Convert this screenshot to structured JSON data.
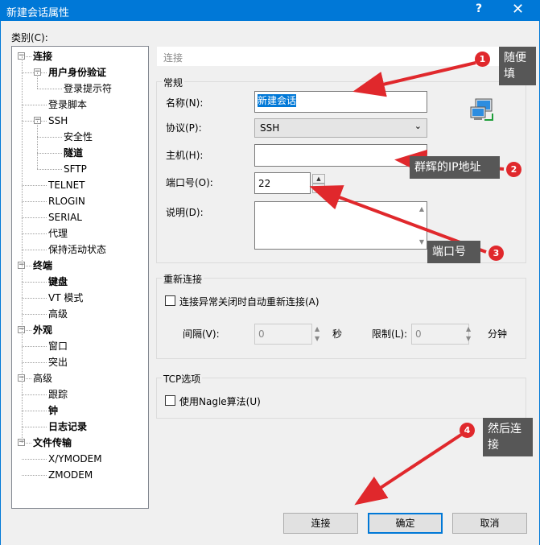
{
  "window": {
    "title": "新建会话属性",
    "help": "?",
    "close": "✕"
  },
  "category_label": "类别(C):",
  "tree": [
    {
      "label": "连接",
      "bold": true,
      "level": 0,
      "exp": "−"
    },
    {
      "label": "用户身份验证",
      "bold": true,
      "level": 1,
      "exp": "−"
    },
    {
      "label": "登录提示符",
      "bold": false,
      "level": 2
    },
    {
      "label": "登录脚本",
      "bold": false,
      "level": 1
    },
    {
      "label": "SSH",
      "bold": false,
      "level": 1,
      "exp": "−"
    },
    {
      "label": "安全性",
      "bold": false,
      "level": 2
    },
    {
      "label": "隧道",
      "bold": true,
      "level": 2
    },
    {
      "label": "SFTP",
      "bold": false,
      "level": 2
    },
    {
      "label": "TELNET",
      "bold": false,
      "level": 1
    },
    {
      "label": "RLOGIN",
      "bold": false,
      "level": 1
    },
    {
      "label": "SERIAL",
      "bold": false,
      "level": 1
    },
    {
      "label": "代理",
      "bold": false,
      "level": 1
    },
    {
      "label": "保持活动状态",
      "bold": false,
      "level": 1
    },
    {
      "label": "终端",
      "bold": true,
      "level": 0,
      "exp": "−"
    },
    {
      "label": "键盘",
      "bold": true,
      "level": 1
    },
    {
      "label": "VT 模式",
      "bold": false,
      "level": 1
    },
    {
      "label": "高级",
      "bold": false,
      "level": 1
    },
    {
      "label": "外观",
      "bold": true,
      "level": 0,
      "exp": "−"
    },
    {
      "label": "窗口",
      "bold": false,
      "level": 1
    },
    {
      "label": "突出",
      "bold": false,
      "level": 1
    },
    {
      "label": "高级",
      "bold": false,
      "level": 0,
      "exp": "−"
    },
    {
      "label": "跟踪",
      "bold": false,
      "level": 1
    },
    {
      "label": "钟",
      "bold": true,
      "level": 1
    },
    {
      "label": "日志记录",
      "bold": true,
      "level": 1
    },
    {
      "label": "文件传输",
      "bold": true,
      "level": 0,
      "exp": "−"
    },
    {
      "label": "X/YMODEM",
      "bold": false,
      "level": 1
    },
    {
      "label": "ZMODEM",
      "bold": false,
      "level": 1
    }
  ],
  "breadcrumb": "连接",
  "general": {
    "title": "常规",
    "name_label": "名称(N):",
    "name_value": "新建会话",
    "protocol_label": "协议(P):",
    "protocol_value": "SSH",
    "protocol_chevron": "⌄",
    "host_label": "主机(H):",
    "host_value": "",
    "port_label": "端口号(O):",
    "port_value": "22",
    "desc_label": "说明(D):",
    "desc_value": ""
  },
  "reconnect": {
    "title": "重新连接",
    "checkbox_label": "连接异常关闭时自动重新连接(A)",
    "interval_label": "间隔(V):",
    "interval_value": "0",
    "interval_unit": "秒",
    "limit_label": "限制(L):",
    "limit_value": "0",
    "limit_unit": "分钟"
  },
  "tcp": {
    "title": "TCP选项",
    "nagle_label": "使用Nagle算法(U)"
  },
  "buttons": {
    "connect": "连接",
    "ok": "确定",
    "cancel": "取消"
  },
  "annotations": {
    "n1": "1",
    "note1_line1": "随便",
    "note1_line2": "填",
    "n2": "2",
    "note2": "群辉的IP地址",
    "n3": "3",
    "note3": "端口号",
    "n4": "4",
    "note4_line1": "然后连",
    "note4_line2": "接",
    "color": "#e0282c"
  },
  "colors": {
    "titlebar": "#0078d7",
    "accent": "#0078d7",
    "annotation": "#e0282c",
    "note_bg": "#575757"
  }
}
